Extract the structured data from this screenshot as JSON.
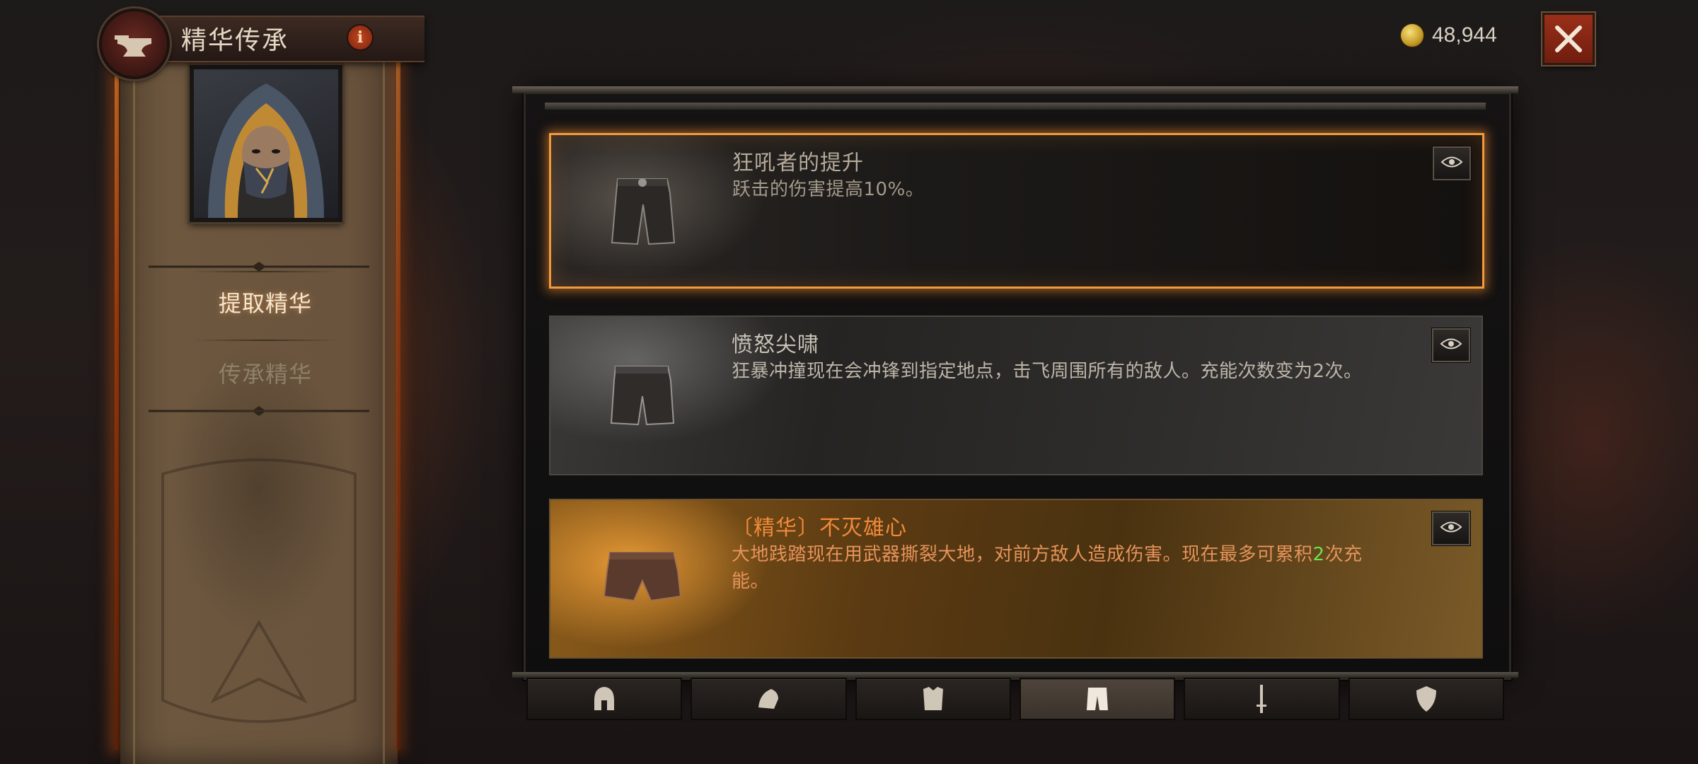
{
  "header": {
    "title": "精华传承",
    "info_label": "i"
  },
  "currency": {
    "gold_amount": "48,944"
  },
  "sidebar": {
    "items": [
      {
        "label": "提取精华",
        "active": true
      },
      {
        "label": "传承精华",
        "active": false
      }
    ]
  },
  "cards": [
    {
      "title": "狂吼者的提升",
      "description": "跃击的伤害提高10%。",
      "item_icon": "pants-icon",
      "selected": true
    },
    {
      "title": "愤怒尖啸",
      "description": "狂暴冲撞现在会冲锋到指定地点，击飞周围所有的敌人。充能次数变为2次。",
      "item_icon": "pants-icon",
      "selected": false
    },
    {
      "title": "〔精华〕不灭雄心",
      "description_before": "大地践踏现在用武器撕裂大地，对前方敌人造成伤害。现在最多可累积",
      "description_highlight": "2",
      "description_after": "次充能。",
      "item_icon": "pants-icon",
      "selected": false
    }
  ],
  "tabs": [
    {
      "icon": "helmet-icon",
      "active": false
    },
    {
      "icon": "shoulder-icon",
      "active": false
    },
    {
      "icon": "chest-armor-icon",
      "active": false
    },
    {
      "icon": "pants-icon",
      "active": true
    },
    {
      "icon": "weapon-icon",
      "active": false
    },
    {
      "icon": "offhand-shield-icon",
      "active": false
    }
  ],
  "colors": {
    "legendary_text": "#f08a3a",
    "highlight_number": "#6fe04a",
    "selected_border": "#f29a3c",
    "close_button": "#9a2f19"
  }
}
